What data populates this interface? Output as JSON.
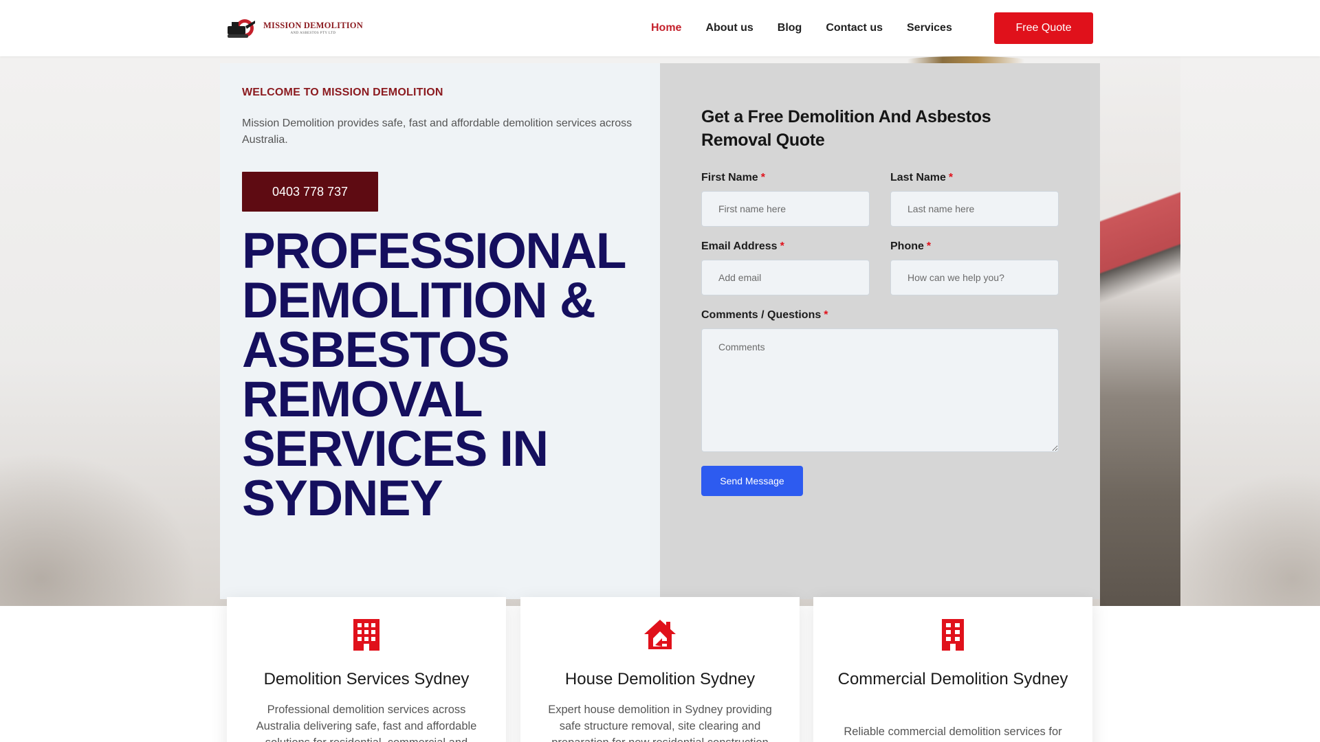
{
  "header": {
    "logo_name": "MISSION DEMOLITION",
    "logo_sub": "AND ASBESTOS PTY LTD",
    "nav": [
      {
        "label": "Home",
        "active": true
      },
      {
        "label": "About us",
        "active": false
      },
      {
        "label": "Blog",
        "active": false
      },
      {
        "label": "Contact us",
        "active": false
      },
      {
        "label": "Services",
        "active": false
      }
    ],
    "cta_label": "Free Quote"
  },
  "hero": {
    "welcome": "WELCOME TO MISSION DEMOLITION",
    "intro": "Mission Demolition provides safe, fast and affordable demolition services across Australia.",
    "phone_label": "0403 778 737",
    "title_lines": [
      "PROFESSIONAL",
      "DEMOLITION &",
      "ASBESTOS",
      "REMOVAL",
      "SERVICES IN",
      "SYDNEY"
    ]
  },
  "form": {
    "title": "Get a Free Demolition And Asbestos Removal Quote",
    "first_name": {
      "label": "First Name",
      "placeholder": "First name here",
      "value": ""
    },
    "last_name": {
      "label": "Last Name",
      "placeholder": "Last name here",
      "value": ""
    },
    "email": {
      "label": "Email Address",
      "placeholder": "Add email",
      "value": ""
    },
    "phone": {
      "label": "Phone",
      "placeholder": "How can we help you?",
      "value": ""
    },
    "comments": {
      "label": "Comments / Questions",
      "placeholder": "Comments",
      "value": ""
    },
    "required_mark": "*",
    "submit_label": "Send Message"
  },
  "services": [
    {
      "icon": "building-icon",
      "title": "Demolition Services Sydney",
      "desc": "Professional demolition services across Australia delivering safe, fast and affordable solutions for residential, commercial and"
    },
    {
      "icon": "house-icon",
      "title": "House Demolition Sydney",
      "desc": "Expert house demolition in Sydney providing safe structure removal, site clearing and preparation for new residential construction"
    },
    {
      "icon": "office-building-icon",
      "title": "Commercial Demolition Sydney",
      "desc": "Reliable commercial demolition services for"
    }
  ],
  "colors": {
    "brand_red": "#e0111b",
    "brand_maroon": "#5e0b12",
    "heading_navy": "#150f5e",
    "send_blue": "#2d5bf0"
  }
}
